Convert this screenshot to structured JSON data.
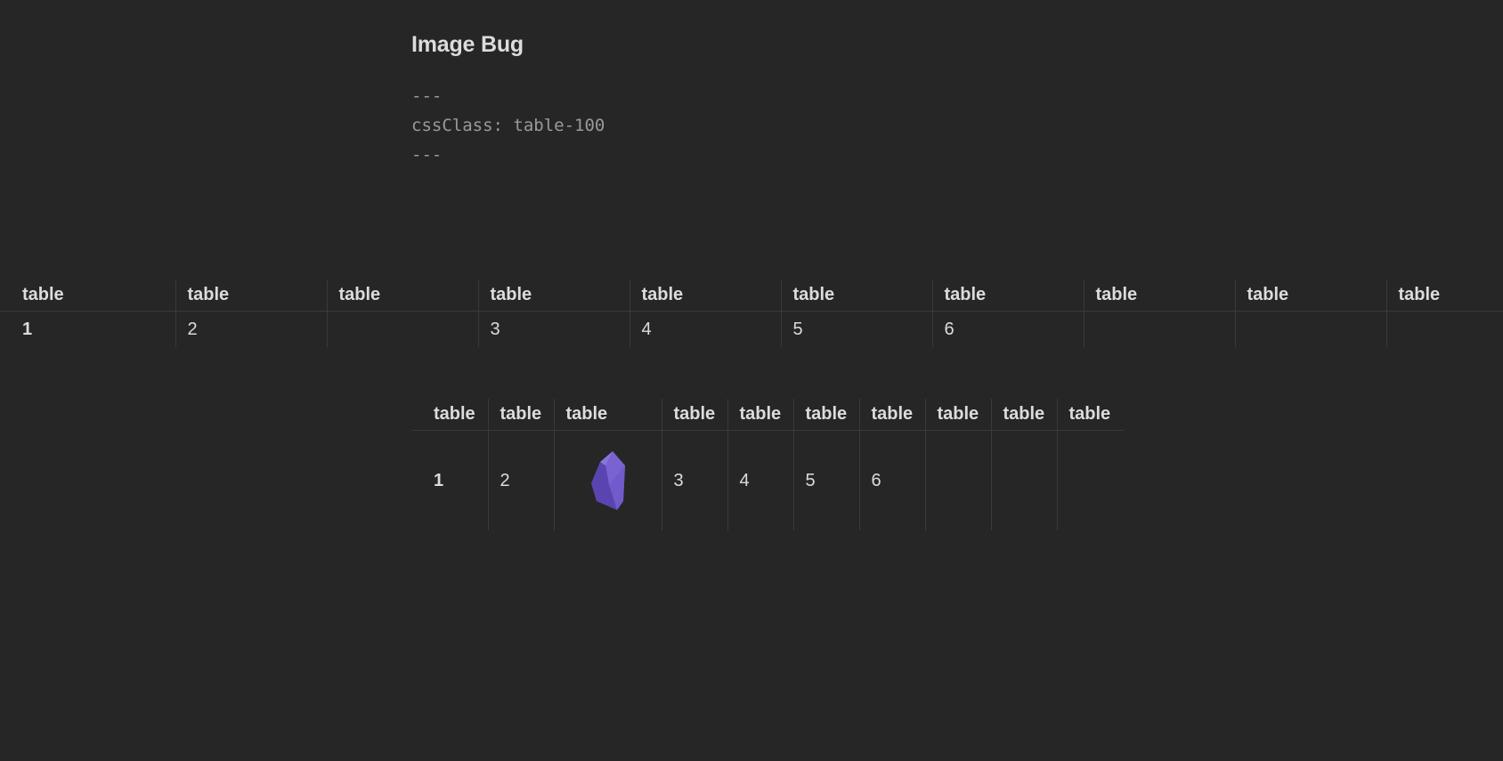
{
  "note": {
    "title": "Image Bug",
    "frontmatter_open": "---",
    "frontmatter_line": "cssClass: table-100",
    "frontmatter_close": "---"
  },
  "wide_table": {
    "headers": [
      "table",
      "table",
      "table",
      "table",
      "table",
      "table",
      "table",
      "table",
      "table",
      "table"
    ],
    "row": [
      "1",
      "2",
      "",
      "3",
      "4",
      "5",
      "6",
      "",
      "",
      ""
    ]
  },
  "narrow_table": {
    "headers": [
      "table",
      "table",
      "table",
      "table",
      "table",
      "table",
      "table",
      "table",
      "table",
      "table"
    ],
    "row": [
      "1",
      "2",
      "",
      "3",
      "4",
      "5",
      "6",
      "",
      "",
      ""
    ],
    "image_cell_icon": "obsidian-crystal-icon"
  },
  "colors": {
    "background": "#262626",
    "text": "#dcdcdc",
    "muted": "#9a9a9a",
    "border": "#3a3a3a",
    "crystal": "#6f56c4"
  }
}
